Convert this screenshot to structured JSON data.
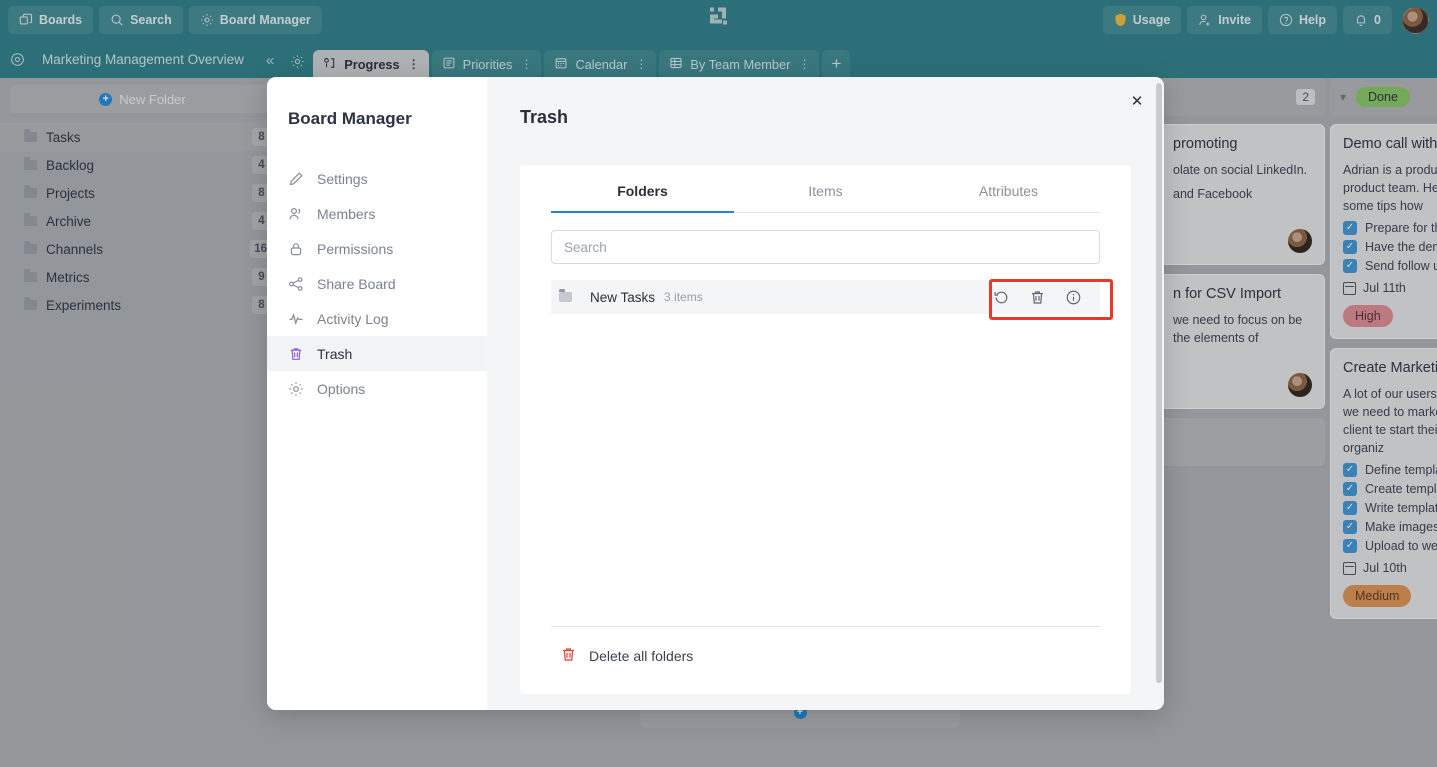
{
  "topbar": {
    "left_buttons": [
      {
        "label": "Boards",
        "icon": "boards-icon"
      },
      {
        "label": "Search",
        "icon": "search-icon"
      },
      {
        "label": "Board Manager",
        "icon": "gear-icon"
      }
    ],
    "logo": "app-logo",
    "right_buttons": [
      {
        "label": "Usage",
        "icon": "shield-icon"
      },
      {
        "label": "Invite",
        "icon": "user-plus-icon"
      },
      {
        "label": "Help",
        "icon": "question-circle-icon"
      },
      {
        "label": "0",
        "icon": "bell-icon"
      }
    ],
    "avatar": "user-avatar",
    "brand_color": "#2f7d86"
  },
  "tabbar": {
    "board_title": "Marketing Management Overview",
    "collapse": "«",
    "tabs": [
      {
        "label": "Progress",
        "icon": "kanban-icon",
        "active": true
      },
      {
        "label": "Priorities",
        "icon": "list-icon",
        "active": false
      },
      {
        "label": "Calendar",
        "icon": "calendar-icon",
        "active": false
      },
      {
        "label": "By Team Member",
        "icon": "table-icon",
        "active": false
      }
    ],
    "add_tab": "+"
  },
  "sidebar": {
    "new_folder_label": "New Folder",
    "folders": [
      {
        "name": "Tasks",
        "count": "8"
      },
      {
        "name": "Backlog",
        "count": "4"
      },
      {
        "name": "Projects",
        "count": "8"
      },
      {
        "name": "Archive",
        "count": "4"
      },
      {
        "name": "Channels",
        "count": "16"
      },
      {
        "name": "Metrics",
        "count": "9"
      },
      {
        "name": "Experiments",
        "count": "8"
      }
    ]
  },
  "board": {
    "columns": [
      {
        "count_badge": "2",
        "status": "",
        "cards": [
          {
            "title": "promoting",
            "body": "olate on social LinkedIn.",
            "extra": "and Facebook",
            "checks": [],
            "date": "",
            "priority": ""
          },
          {
            "title": "n for CSV Import",
            "body": "we need to focus on be the elements of",
            "extra": "",
            "checks": [],
            "date": "",
            "priority": ""
          }
        ]
      },
      {
        "count_badge": "",
        "status": "Done",
        "cards": [
          {
            "title": "Demo call with ",
            "body": "Adrian is a produc product team. He and some tips how",
            "extra": "",
            "checks": [
              "Prepare for the",
              "Have the demo",
              "Send follow up"
            ],
            "date": "Jul 11th",
            "priority": "High"
          },
          {
            "title": "Create Marketin",
            "body": "A lot of our users niche, we need to marketing client te start their organiz",
            "extra": "",
            "checks": [
              "Define templat",
              "Create templa",
              "Write template",
              "Make images",
              "Upload to web"
            ],
            "date": "Jul 10th",
            "priority": "Medium"
          }
        ]
      }
    ]
  },
  "modal": {
    "title": "Board Manager",
    "close_label": "✕",
    "nav_items": [
      {
        "label": "Settings",
        "icon": "pencil-icon",
        "active": false
      },
      {
        "label": "Members",
        "icon": "users-icon",
        "active": false
      },
      {
        "label": "Permissions",
        "icon": "lock-icon",
        "active": false
      },
      {
        "label": "Share Board",
        "icon": "share-icon",
        "active": false
      },
      {
        "label": "Activity Log",
        "icon": "activity-icon",
        "active": false
      },
      {
        "label": "Trash",
        "icon": "trash-icon",
        "active": true
      },
      {
        "label": "Options",
        "icon": "gear-icon",
        "active": false
      }
    ],
    "page_title": "Trash",
    "tabs": [
      {
        "label": "Folders",
        "active": true
      },
      {
        "label": "Items",
        "active": false
      },
      {
        "label": "Attributes",
        "active": false
      }
    ],
    "search_placeholder": "Search",
    "search_value": "",
    "rows": [
      {
        "name": "New Tasks",
        "count": "3 items",
        "actions": [
          {
            "name": "restore-icon",
            "title": "Restore"
          },
          {
            "name": "delete-icon",
            "title": "Delete"
          },
          {
            "name": "info-icon",
            "title": "Info"
          }
        ]
      }
    ],
    "delete_all_label": "Delete all folders",
    "highlight_color": "#e8392c",
    "accent_color": "#1e88d6"
  }
}
